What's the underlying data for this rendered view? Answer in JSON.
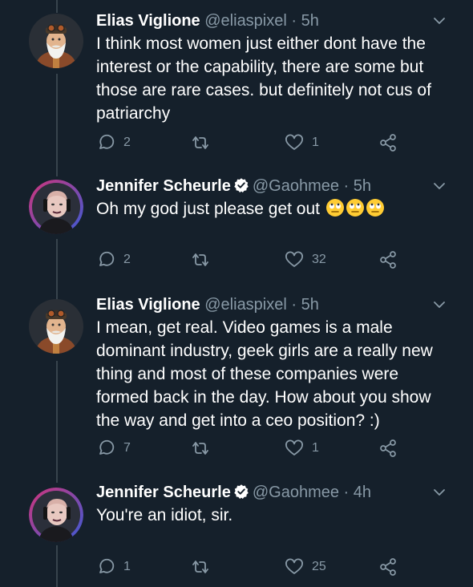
{
  "tweets": [
    {
      "name": "Elias Viglione",
      "handle": "@eliaspixel",
      "separator": "·",
      "time": "5h",
      "verified": false,
      "avatar": "elias-avatar",
      "lines": [
        "I think most women just either dont have the",
        "interest or the capability, there are some but",
        "those are rare cases. but definitely not cus of",
        "patriarchy"
      ],
      "reply_count": "2",
      "retweet_count": "",
      "like_count": "1"
    },
    {
      "name": "Jennifer Scheurle",
      "handle": "@Gaohmee",
      "separator": "·",
      "time": "5h",
      "verified": true,
      "avatar": "jennifer-avatar",
      "lines": [
        "Oh my god just please get out"
      ],
      "emoji": [
        "eye-roll-emoji",
        "eye-roll-emoji",
        "eye-roll-emoji"
      ],
      "reply_count": "2",
      "retweet_count": "",
      "like_count": "32"
    },
    {
      "name": "Elias Viglione",
      "handle": "@eliaspixel",
      "separator": "·",
      "time": "5h",
      "verified": false,
      "avatar": "elias-avatar",
      "lines": [
        "I mean, get real. Video games is a male",
        "dominant industry, geek girls are a really new",
        "thing and most of these companies were",
        "formed back in the day. How about you show",
        "the way and get into a ceo position? :)"
      ],
      "reply_count": "7",
      "retweet_count": "",
      "like_count": "1"
    },
    {
      "name": "Jennifer Scheurle",
      "handle": "@Gaohmee",
      "separator": "·",
      "time": "4h",
      "verified": true,
      "avatar": "jennifer-avatar",
      "lines": [
        "You're an idiot, sir."
      ],
      "reply_count": "1",
      "retweet_count": "",
      "like_count": "25"
    }
  ],
  "icons": {
    "reply": "reply-icon",
    "retweet": "retweet-icon",
    "like": "heart-icon",
    "share": "share-icon",
    "caret": "chevron-down-icon",
    "verified": "verified-badge-icon"
  },
  "colors": {
    "background": "#15202b",
    "text": "#ffffff",
    "muted": "#8899a6",
    "verified": "#ffffff",
    "thread_line": "#38444d"
  }
}
